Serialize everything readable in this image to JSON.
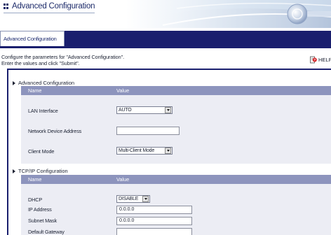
{
  "banner": {
    "title": "Advanced Configuration"
  },
  "tab": {
    "label": "Advanced Configuration"
  },
  "description": {
    "line1": "Configure the parameters for \"Advanced Configuration\".",
    "line2": "Enter the values and click \"Submit\"."
  },
  "help": {
    "label": "HELP"
  },
  "advanced": {
    "title": "Advanced Configuration",
    "col_name": "Name",
    "col_value": "Value",
    "lan_label": "LAN Interface",
    "lan_value": "AUTO",
    "nda_label": "Network Device Address",
    "nda_value": "",
    "client_label": "Client Mode",
    "client_value": "Multi-Client Mode"
  },
  "tcpip": {
    "title": "TCP/IP Configuration",
    "col_name": "Name",
    "col_value": "Value",
    "dhcp_label": "DHCP",
    "dhcp_value": "DISABLE",
    "ip_label": "IP Address",
    "ip_value": "0.0.0.0",
    "subnet_label": "Subnet Mask",
    "subnet_value": "0.0.0.0",
    "gateway_label": "Default Gateway",
    "gateway_value": ""
  },
  "colors": {
    "navy": "#1a1f6e",
    "table_header": "#8d94bd",
    "table_body": "#ecedf4"
  }
}
